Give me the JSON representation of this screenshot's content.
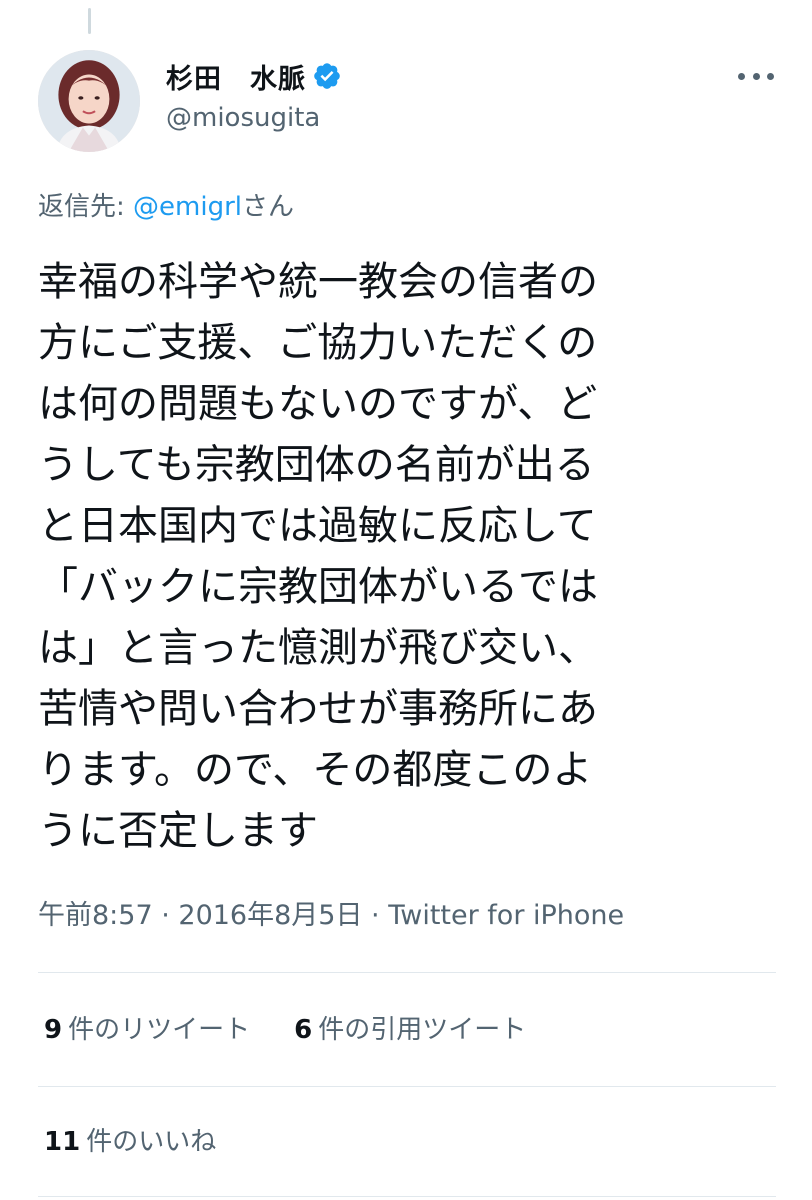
{
  "author": {
    "display_name": "杉田　水脈",
    "handle": "@miosugita",
    "verified": true
  },
  "reply": {
    "prefix": "返信先: ",
    "mention": "@emigrl",
    "suffix": "さん"
  },
  "tweet": {
    "lines": [
      "幸福の科学や統一教会の信者の",
      "方にご支援、ご協力いただくの",
      "は何の問題もないのですが、ど",
      "うしても宗教団体の名前が出る",
      "と日本国内では過敏に反応して",
      "「バックに宗教団体がいるでは",
      "は」と言った憶測が飛び交い、",
      "苦情や問い合わせが事務所にあ",
      "ります。ので、その都度このよ",
      "うに否定します"
    ]
  },
  "meta": {
    "time": "午前8:57",
    "separator": " · ",
    "date": "2016年8月5日",
    "source": "Twitter for iPhone"
  },
  "stats": {
    "retweets_count": "9",
    "retweets_label": "件のリツイート",
    "quotes_count": "6",
    "quotes_label": "件の引用ツイート",
    "likes_count": "11",
    "likes_label": "件のいいね"
  },
  "colors": {
    "accent": "#1d9bf0",
    "text": "#0f1419",
    "secondary": "#536471",
    "divider": "#e1e8ed"
  },
  "icons": {
    "verified": "verified-badge-icon",
    "more": "more-options-icon"
  }
}
